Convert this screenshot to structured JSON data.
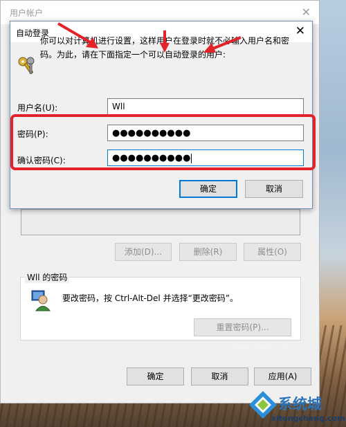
{
  "parent": {
    "title": "用户帐户",
    "add_label": "添加(D)...",
    "delete_label": "删除(R)",
    "properties_label": "属性(O)",
    "password_group_label": "Wll 的密码",
    "password_text": "要改密码，按 Ctrl-Alt-Del 并选择“更改密码”。",
    "reset_password_label": "重置密码(P)...",
    "ok_label": "确定",
    "cancel_label": "取消",
    "apply_label": "应用(A)"
  },
  "dialog": {
    "title": "自动登录",
    "description_line1": "你可以对计算机进行设置，这样用户在登录时就不必输入用户名和密",
    "description_line2": "码。为此，请在下面指定一个可以自动登录的用户:",
    "username_label": "用户名(U):",
    "username_value": "Wll",
    "password_label": "密码(P):",
    "password_value": "●●●●●●●●●●",
    "confirm_label": "确认密码(C):",
    "confirm_value": "●●●●●●●●●●",
    "ok_label": "确定",
    "cancel_label": "取消"
  },
  "watermark": {
    "text": "系统城",
    "url": "xitongcheng.com",
    "faint": "jingyan.baidu.com"
  },
  "colors": {
    "highlight_red": "#e5222a",
    "focus_blue": "#0078d7"
  }
}
